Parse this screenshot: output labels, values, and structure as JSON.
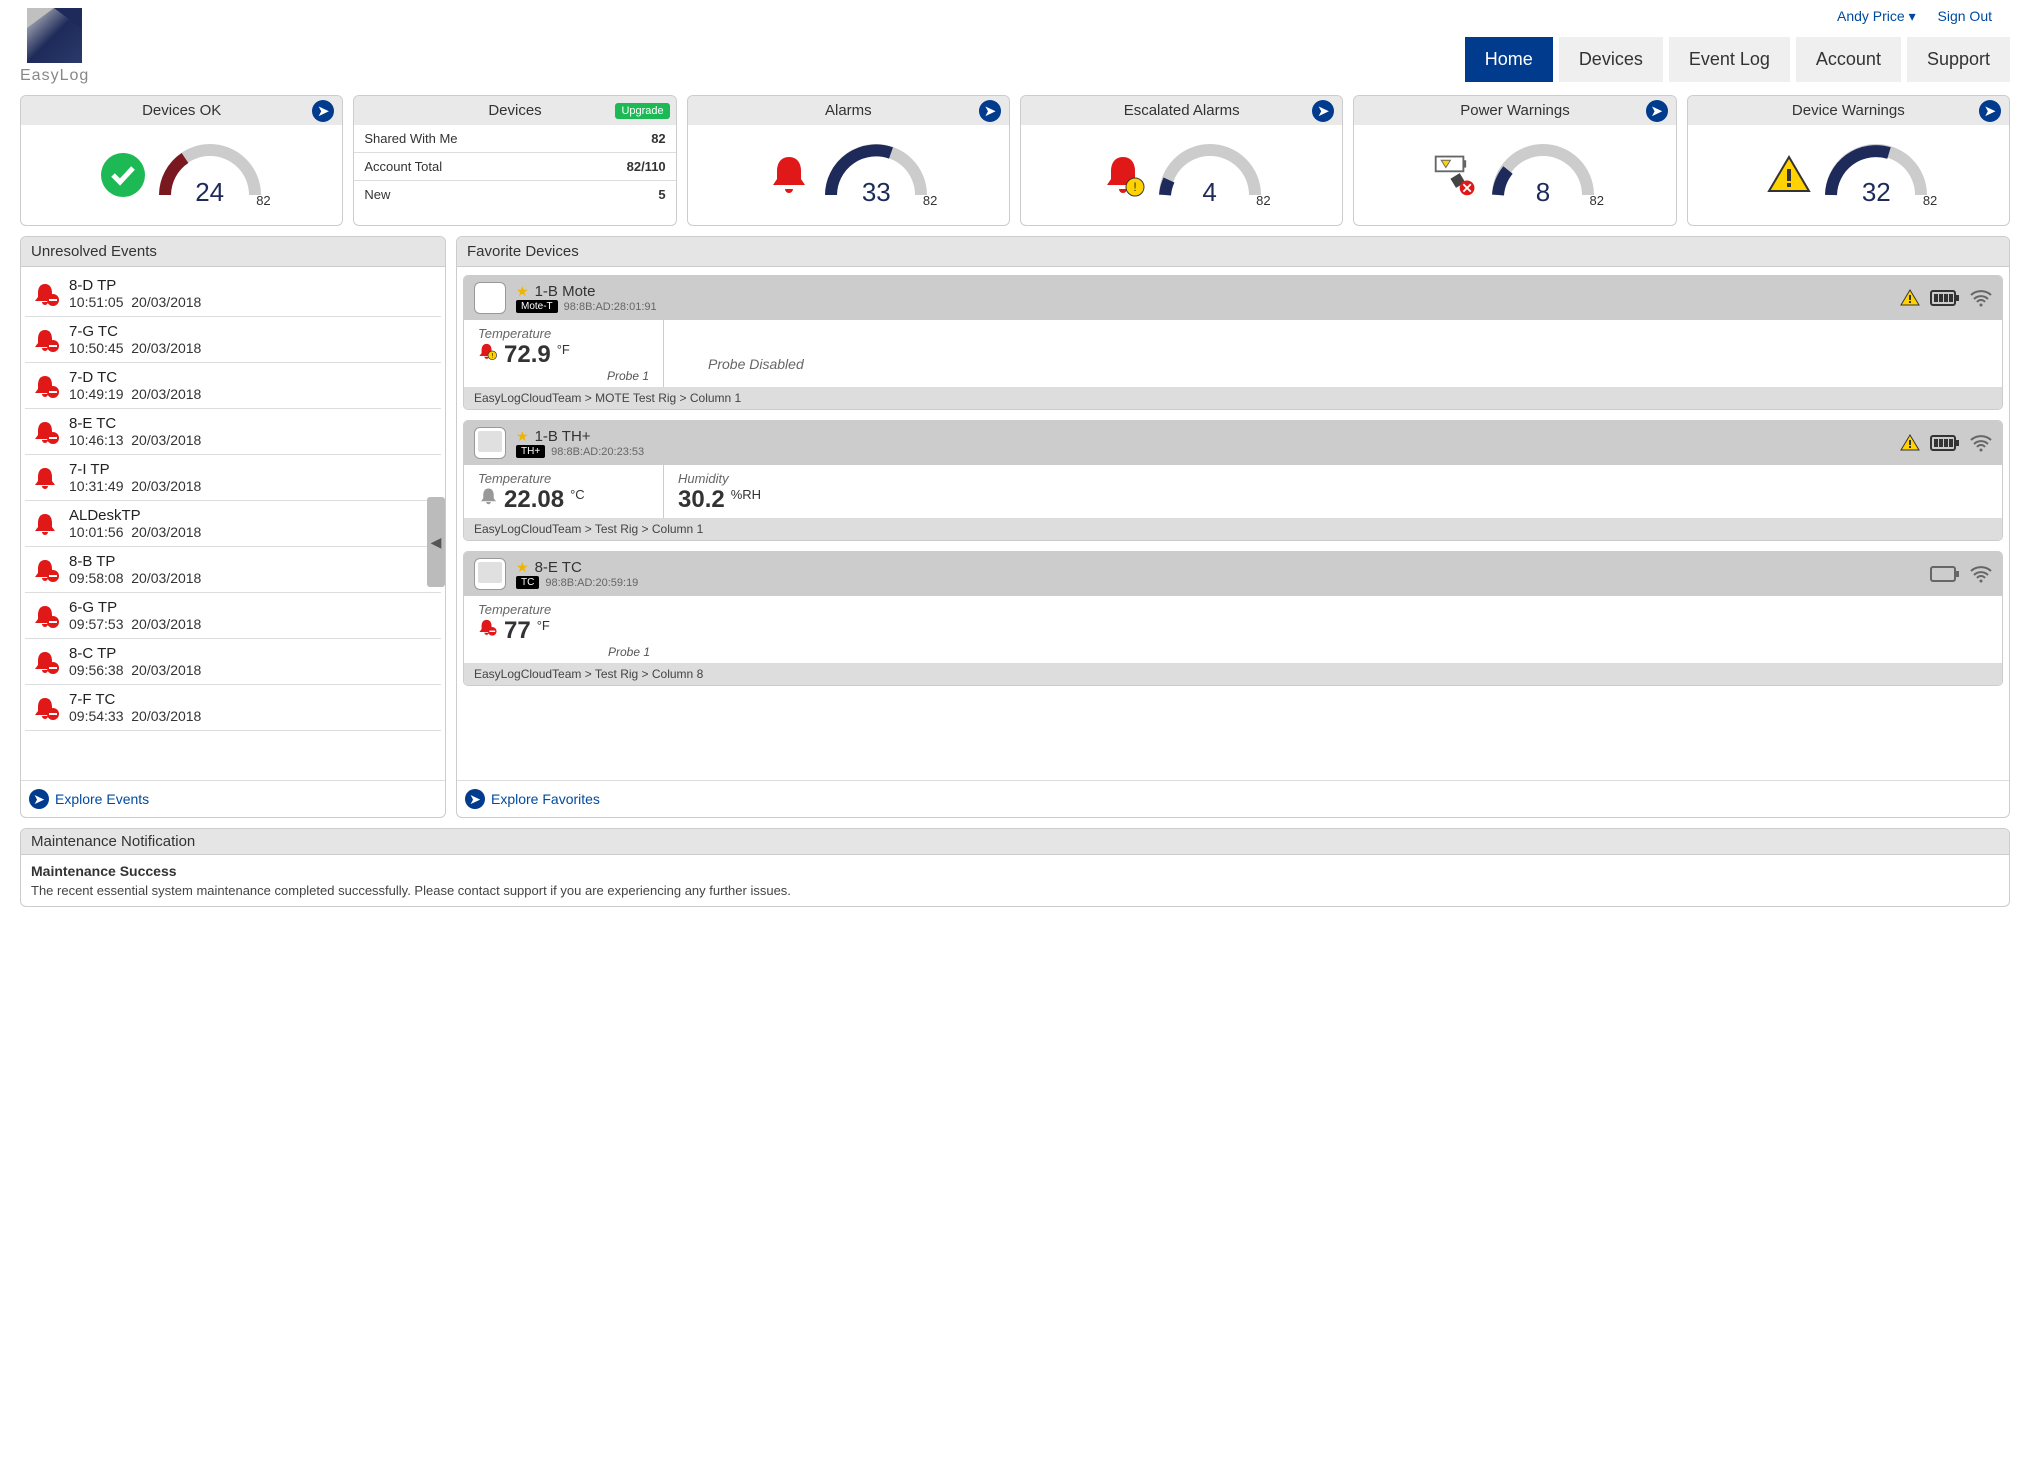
{
  "header": {
    "logo_text": "EasyLog",
    "user_name": "Andy Price",
    "sign_out": "Sign Out"
  },
  "nav": [
    {
      "label": "Home",
      "active": true
    },
    {
      "label": "Devices",
      "active": false
    },
    {
      "label": "Event Log",
      "active": false
    },
    {
      "label": "Account",
      "active": false
    },
    {
      "label": "Support",
      "active": false
    }
  ],
  "cards": {
    "devices_ok": {
      "title": "Devices OK",
      "value": "24",
      "total": "82"
    },
    "devices": {
      "title": "Devices",
      "upgrade": "Upgrade",
      "rows": [
        {
          "label": "Shared With Me",
          "value": "82"
        },
        {
          "label": "Account Total",
          "value": "82/110"
        },
        {
          "label": "New",
          "value": "5"
        }
      ]
    },
    "alarms": {
      "title": "Alarms",
      "value": "33",
      "total": "82"
    },
    "escalated": {
      "title": "Escalated Alarms",
      "value": "4",
      "total": "82"
    },
    "power": {
      "title": "Power Warnings",
      "value": "8",
      "total": "82"
    },
    "device_warn": {
      "title": "Device Warnings",
      "value": "32",
      "total": "82"
    }
  },
  "unresolved": {
    "title": "Unresolved Events",
    "items": [
      {
        "name": "8-D TP",
        "time": "10:51:05",
        "date": "20/03/2018",
        "icon": "bell-minus"
      },
      {
        "name": "7-G TC",
        "time": "10:50:45",
        "date": "20/03/2018",
        "icon": "bell-minus"
      },
      {
        "name": "7-D TC",
        "time": "10:49:19",
        "date": "20/03/2018",
        "icon": "bell-minus"
      },
      {
        "name": "8-E TC",
        "time": "10:46:13",
        "date": "20/03/2018",
        "icon": "bell-minus"
      },
      {
        "name": "7-I TP",
        "time": "10:31:49",
        "date": "20/03/2018",
        "icon": "bell"
      },
      {
        "name": "ALDeskTP",
        "time": "10:01:56",
        "date": "20/03/2018",
        "icon": "bell"
      },
      {
        "name": "8-B TP",
        "time": "09:58:08",
        "date": "20/03/2018",
        "icon": "bell-minus"
      },
      {
        "name": "6-G TP",
        "time": "09:57:53",
        "date": "20/03/2018",
        "icon": "bell-minus"
      },
      {
        "name": "8-C TP",
        "time": "09:56:38",
        "date": "20/03/2018",
        "icon": "bell-minus"
      },
      {
        "name": "7-F TC",
        "time": "09:54:33",
        "date": "20/03/2018",
        "icon": "bell-minus"
      }
    ],
    "explore": "Explore Events"
  },
  "favorites": {
    "title": "Favorite Devices",
    "explore": "Explore Favorites",
    "devices": [
      {
        "name": "1-B Mote",
        "badge": "Mote-T",
        "mac": "98:8B:AD:28:01:91",
        "warn": true,
        "battery": "full",
        "wifi": true,
        "readings": [
          {
            "label": "Temperature",
            "value": "72.9",
            "unit": "°F",
            "probe": "Probe 1",
            "icon": "bell-warn"
          },
          {
            "disabled": "Probe Disabled"
          }
        ],
        "breadcrumb": "EasyLogCloudTeam > MOTE Test Rig > Column 1",
        "img": "mote"
      },
      {
        "name": "1-B TH+",
        "badge": "TH+",
        "mac": "98:8B:AD:20:23:53",
        "warn": true,
        "battery": "full",
        "wifi": true,
        "readings": [
          {
            "label": "Temperature",
            "value": "22.08",
            "unit": "°C",
            "icon": "bell-grey"
          },
          {
            "label": "Humidity",
            "value": "30.2",
            "unit": "%RH"
          }
        ],
        "breadcrumb": "EasyLogCloudTeam > Test Rig > Column 1",
        "img": "tablet"
      },
      {
        "name": "8-E TC",
        "badge": "TC",
        "mac": "98:8B:AD:20:59:19",
        "warn": false,
        "battery": "empty",
        "wifi": true,
        "readings": [
          {
            "label": "Temperature",
            "value": "77",
            "unit": "°F",
            "probe": "Probe 1",
            "icon": "bell-minus"
          }
        ],
        "breadcrumb": "EasyLogCloudTeam > Test Rig > Column 8",
        "img": "tablet"
      }
    ]
  },
  "maintenance": {
    "header": "Maintenance Notification",
    "title": "Maintenance Success",
    "text": "The recent essential system maintenance completed successfully. Please contact support if you are experiencing any further issues."
  }
}
